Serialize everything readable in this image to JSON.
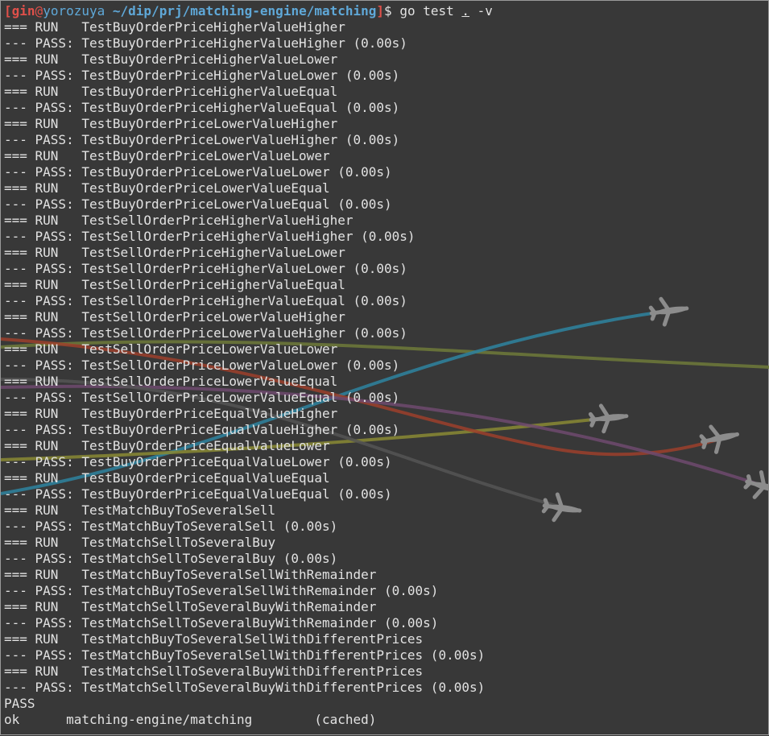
{
  "prompt": {
    "open_bracket": "[",
    "user": "gin",
    "at": "@",
    "host": "yorozuya",
    "path": "~/dip/prj/matching-engine/matching",
    "close_bracket": "]",
    "dollar": "$",
    "command": " go test ",
    "dot": ".",
    "flag": " -v"
  },
  "output_lines": [
    "=== RUN   TestBuyOrderPriceHigherValueHigher",
    "--- PASS: TestBuyOrderPriceHigherValueHigher (0.00s)",
    "=== RUN   TestBuyOrderPriceHigherValueLower",
    "--- PASS: TestBuyOrderPriceHigherValueLower (0.00s)",
    "=== RUN   TestBuyOrderPriceHigherValueEqual",
    "--- PASS: TestBuyOrderPriceHigherValueEqual (0.00s)",
    "=== RUN   TestBuyOrderPriceLowerValueHigher",
    "--- PASS: TestBuyOrderPriceLowerValueHigher (0.00s)",
    "=== RUN   TestBuyOrderPriceLowerValueLower",
    "--- PASS: TestBuyOrderPriceLowerValueLower (0.00s)",
    "=== RUN   TestBuyOrderPriceLowerValueEqual",
    "--- PASS: TestBuyOrderPriceLowerValueEqual (0.00s)",
    "=== RUN   TestSellOrderPriceHigherValueHigher",
    "--- PASS: TestSellOrderPriceHigherValueHigher (0.00s)",
    "=== RUN   TestSellOrderPriceHigherValueLower",
    "--- PASS: TestSellOrderPriceHigherValueLower (0.00s)",
    "=== RUN   TestSellOrderPriceHigherValueEqual",
    "--- PASS: TestSellOrderPriceHigherValueEqual (0.00s)",
    "=== RUN   TestSellOrderPriceLowerValueHigher",
    "--- PASS: TestSellOrderPriceLowerValueHigher (0.00s)",
    "=== RUN   TestSellOrderPriceLowerValueLower",
    "--- PASS: TestSellOrderPriceLowerValueLower (0.00s)",
    "=== RUN   TestSellOrderPriceLowerValueEqual",
    "--- PASS: TestSellOrderPriceLowerValueEqual (0.00s)",
    "=== RUN   TestBuyOrderPriceEqualValueHigher",
    "--- PASS: TestBuyOrderPriceEqualValueHigher (0.00s)",
    "=== RUN   TestBuyOrderPriceEqualValueLower",
    "--- PASS: TestBuyOrderPriceEqualValueLower (0.00s)",
    "=== RUN   TestBuyOrderPriceEqualValueEqual",
    "--- PASS: TestBuyOrderPriceEqualValueEqual (0.00s)",
    "=== RUN   TestMatchBuyToSeveralSell",
    "--- PASS: TestMatchBuyToSeveralSell (0.00s)",
    "=== RUN   TestMatchSellToSeveralBuy",
    "--- PASS: TestMatchSellToSeveralBuy (0.00s)",
    "=== RUN   TestMatchBuyToSeveralSellWithRemainder",
    "--- PASS: TestMatchBuyToSeveralSellWithRemainder (0.00s)",
    "=== RUN   TestMatchSellToSeveralBuyWithRemainder",
    "--- PASS: TestMatchSellToSeveralBuyWithRemainder (0.00s)",
    "=== RUN   TestMatchBuyToSeveralSellWithDifferentPrices",
    "--- PASS: TestMatchBuyToSeveralSellWithDifferentPrices (0.00s)",
    "=== RUN   TestMatchSellToSeveralBuyWithDifferentPrices",
    "--- PASS: TestMatchSellToSeveralBuyWithDifferentPrices (0.00s)",
    "PASS",
    "ok      matching-engine/matching        (cached)"
  ],
  "colors": {
    "background": "#383838",
    "text": "#e2e2e2",
    "prompt_user": "#e0504a",
    "prompt_path": "#5fa8d8",
    "trail_blue": "#2f7f9a",
    "trail_olive": "#7f8a3a",
    "trail_red": "#a0402e",
    "trail_purple": "#6e4a6e",
    "trail_gray": "#5a5a5a",
    "plane": "#8c8c8c"
  },
  "icons": {
    "wallpaper_planes": [
      "airplane-icon",
      "airplane-icon",
      "airplane-icon",
      "airplane-icon",
      "airplane-icon"
    ]
  }
}
